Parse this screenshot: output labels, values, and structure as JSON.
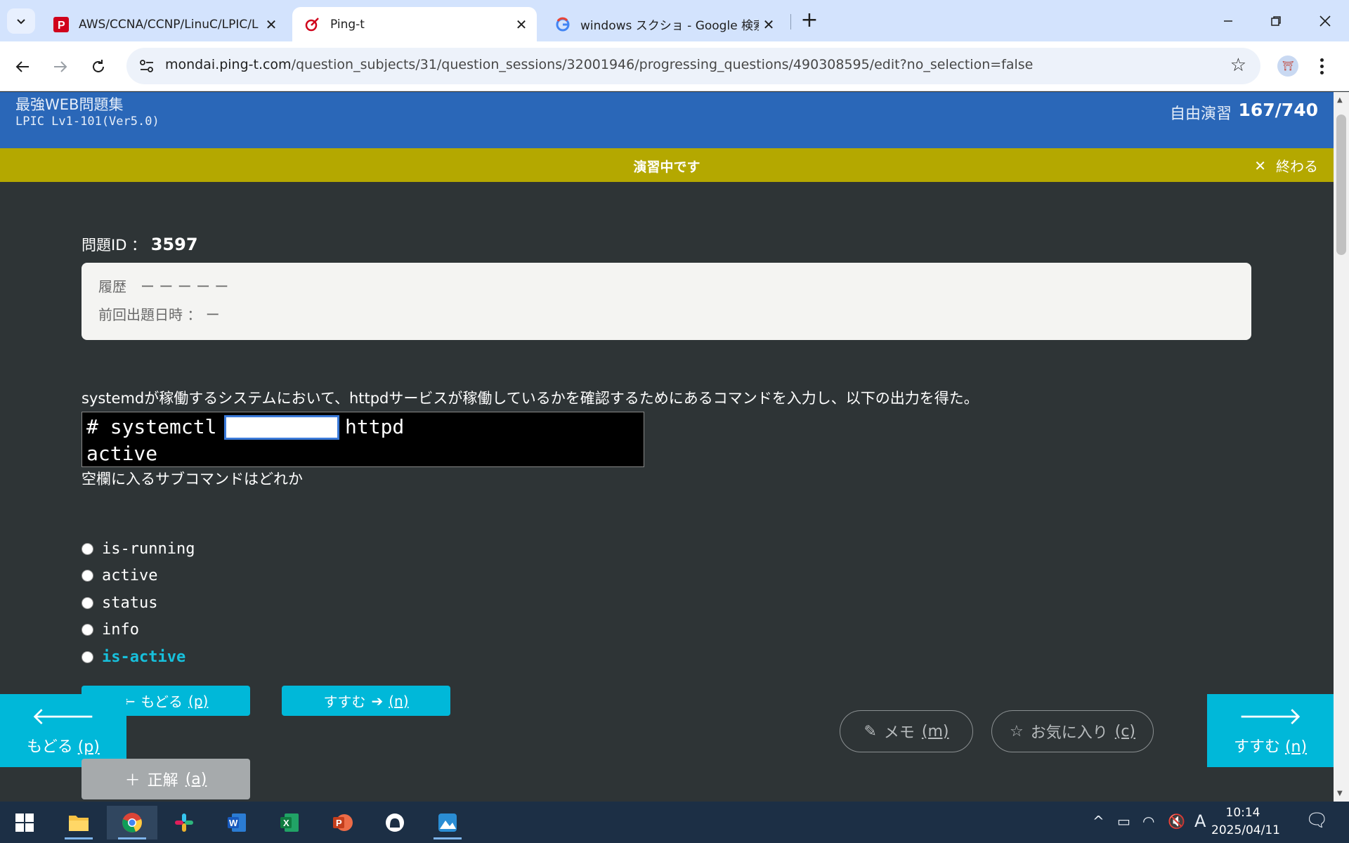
{
  "browser": {
    "tabs": [
      {
        "title": "AWS/CCNA/CCNP/LinuC/LPIC/L",
        "favicon": "ping-t-red-icon",
        "active": false
      },
      {
        "title": "Ping-t",
        "favicon": "ping-t-logo-icon",
        "active": true
      },
      {
        "title": "windows スクショ - Google 検索",
        "favicon": "google-icon",
        "active": false
      }
    ],
    "url_host": "mondai.ping-t.com",
    "url_path": "/question_subjects/31/question_sessions/32001946/progressing_questions/490308595/edit?no_selection=false"
  },
  "header": {
    "brand": "最強WEB問題集",
    "course": "LPIC Lv1-101(Ver5.0)",
    "mode": "自由演習",
    "progress": "167/740"
  },
  "status": {
    "message": "演習中です",
    "quit_label": "終わる"
  },
  "question": {
    "id_label": "問題ID ：",
    "id": "3597",
    "history_label": "履歴　ー ー ー ー ー",
    "last_date_label": "前回出題日時 ： ー",
    "text": "systemdが稼働するシステムにおいて、httpdサービスが稼働しているかを確認するためにあるコマンドを入力し、以下の出力を得た。",
    "terminal_line1": "# systemctl",
    "terminal_line1_after": "httpd",
    "terminal_line2": "active",
    "subtext": "空欄に入るサブコマンドはどれか"
  },
  "choices": [
    {
      "label": "is-running",
      "correct": false
    },
    {
      "label": "active",
      "correct": false
    },
    {
      "label": "status",
      "correct": false
    },
    {
      "label": "info",
      "correct": false
    },
    {
      "label": "is-active",
      "correct": true
    }
  ],
  "buttons": {
    "back_label": "もどる",
    "back_key": "(p)",
    "next_label": "すすむ",
    "next_key": "(n)",
    "memo_label": "メモ",
    "memo_key": "(m)",
    "fav_label": "お気に入り",
    "fav_key": "(c)",
    "answer_label": "正解",
    "answer_key": "(a)"
  },
  "taskbar": {
    "time": "10:14",
    "date": "2025/04/11",
    "ime": "A"
  },
  "colors": {
    "header_blue": "#2a67b8",
    "status_olive": "#b4a800",
    "accent_cyan": "#00b8d9",
    "page_bg": "#2e3436"
  }
}
